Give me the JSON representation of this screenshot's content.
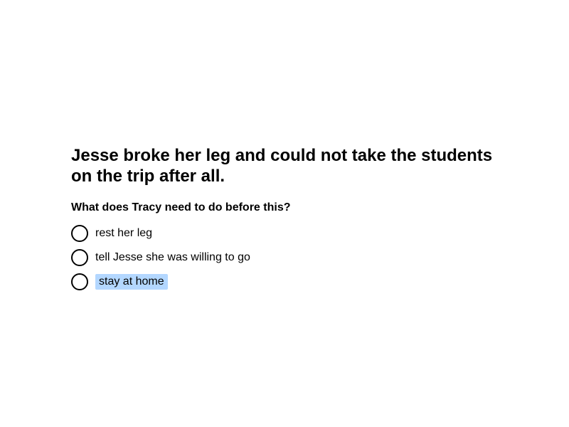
{
  "statement": "Jesse broke her leg and could not take the students on the trip after all.",
  "question": "What does Tracy need to do before this?",
  "options": [
    {
      "label": "rest her leg",
      "highlighted": false
    },
    {
      "label": "tell Jesse she was willing to go",
      "highlighted": false
    },
    {
      "label": "stay at home",
      "highlighted": true
    }
  ],
  "colors": {
    "highlight": "#b3d7ff",
    "text": "#000000",
    "background": "#ffffff"
  },
  "icons": {
    "radio": "radio-unchecked-icon"
  }
}
